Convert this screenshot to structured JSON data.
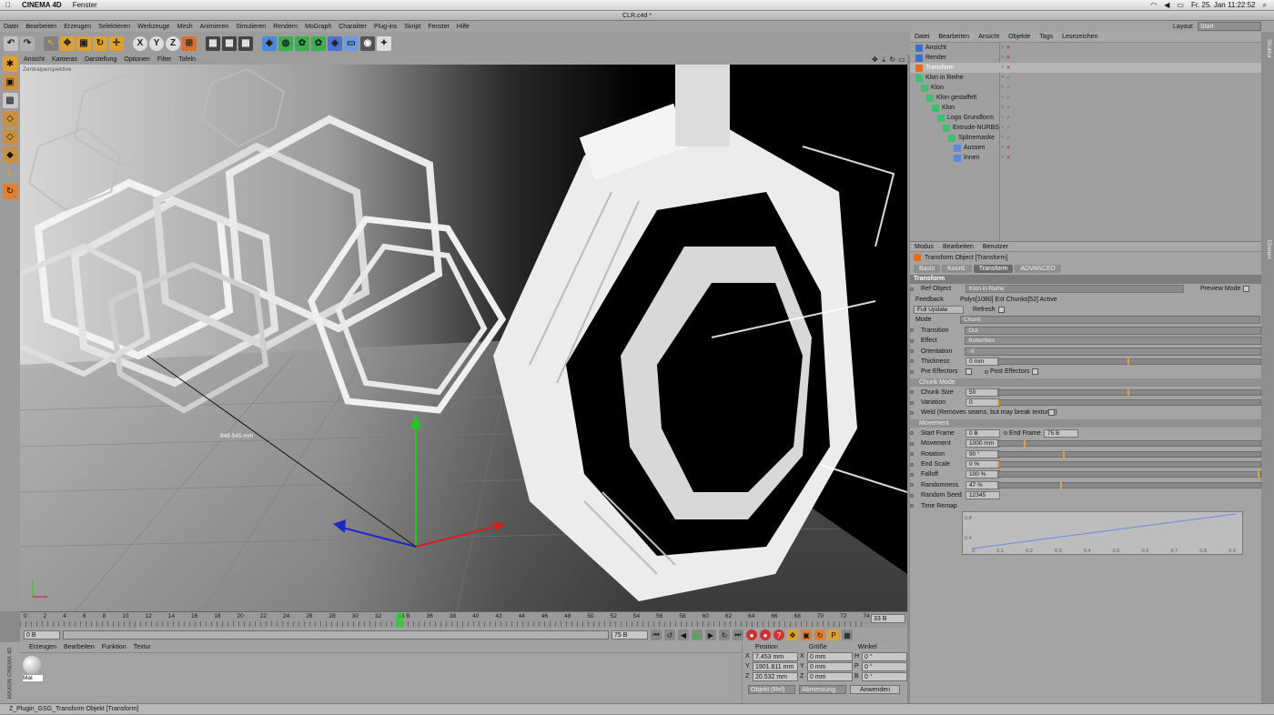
{
  "macbar": {
    "app": "CINEMA 4D",
    "menu": "Fenster",
    "clock": "Fr. 25. Jan  11:22:52"
  },
  "window_title": "CLR.c4d *",
  "main_menu": [
    "Datei",
    "Bearbeiten",
    "Erzeugen",
    "Selektieren",
    "Werkzeuge",
    "Mesh",
    "Animieren",
    "Simulieren",
    "Rendern",
    "MoGraph",
    "Charakter",
    "Plug-ins",
    "Skript",
    "Fenster",
    "Hilfe"
  ],
  "toolbar": {
    "x_label": "X",
    "y_label": "Y",
    "z_label": "Z"
  },
  "viewport": {
    "menu": [
      "Ansicht",
      "Kameras",
      "Darstellung",
      "Optionen",
      "Filter",
      "Tafeln"
    ],
    "name": "Zentralperspektive",
    "measure": "849.545 mm",
    "accent": "#2ad02a"
  },
  "timeline": {
    "ticks": [
      "0",
      "2",
      "4",
      "6",
      "8",
      "10",
      "12",
      "14",
      "16",
      "18",
      "20",
      "22",
      "24",
      "26",
      "28",
      "30",
      "32",
      "33 B",
      "36",
      "38",
      "40",
      "42",
      "44",
      "46",
      "48",
      "50",
      "52",
      "54",
      "56",
      "58",
      "60",
      "62",
      "64",
      "66",
      "68",
      "70",
      "72",
      "74"
    ],
    "end_field": "33 B",
    "start": "0 B",
    "end": "75 B"
  },
  "material": {
    "menu": [
      "Erzeugen",
      "Bearbeiten",
      "Funktion",
      "Textur"
    ],
    "name": "Mat"
  },
  "coords": {
    "headers": [
      "Position",
      "Größe",
      "Winkel"
    ],
    "rows": [
      {
        "axis": "X",
        "pos": "7.453 mm",
        "size_axis": "X",
        "size": "0 mm",
        "ang_axis": "H",
        "ang": "0 °"
      },
      {
        "axis": "Y",
        "pos": "1901.811 mm",
        "size_axis": "Y",
        "size": "0 mm",
        "ang_axis": "P",
        "ang": "0 °"
      },
      {
        "axis": "Z",
        "pos": "20.532 mm",
        "size_axis": "Z",
        "size": "0 mm",
        "ang_axis": "B",
        "ang": "0 °"
      }
    ],
    "btn_obj": "Objekt (Rel)",
    "btn_size": "Abmessung",
    "btn_apply": "Anwenden"
  },
  "status": "Z_Plugin_GSG_Transform Objekt [Transform]",
  "maxon": "MAXON CINEMA 4D",
  "layout": {
    "label": "Layout:",
    "value": "Start"
  },
  "objects": {
    "menu": [
      "Datei",
      "Bearbeiten",
      "Ansicht",
      "Objekte",
      "Tags",
      "Lesezeichen"
    ],
    "items": [
      {
        "name": "Ansicht",
        "indent": 0,
        "color": "#3a6fd0"
      },
      {
        "name": "Render",
        "indent": 0,
        "color": "#3a6fd0"
      },
      {
        "name": "Transform",
        "indent": 0,
        "color": "#e07020",
        "selected": true
      },
      {
        "name": "Klon in Reihe",
        "indent": 0,
        "color": "#3cc070"
      },
      {
        "name": "Klon",
        "indent": 1,
        "color": "#3cc070"
      },
      {
        "name": "Klon gestaffelt",
        "indent": 2,
        "color": "#3cc070"
      },
      {
        "name": "Klon",
        "indent": 3,
        "color": "#3cc070"
      },
      {
        "name": "Logo Grundform",
        "indent": 4,
        "color": "#3cc070"
      },
      {
        "name": "Extrude-NURBS",
        "indent": 5,
        "color": "#3cc070"
      },
      {
        "name": "Splinemaske",
        "indent": 6,
        "color": "#3cc070"
      },
      {
        "name": "Aussen",
        "indent": 7,
        "color": "#5a8ad8"
      },
      {
        "name": "Innen",
        "indent": 7,
        "color": "#5a8ad8"
      }
    ]
  },
  "right_tabs": [
    "Objekte",
    "Content Browser",
    "Struktur"
  ],
  "right_tabs2": [
    "Attribute",
    "Ebenen"
  ],
  "attributes": {
    "menu": [
      "Modus",
      "Bearbeiten",
      "Benutzer"
    ],
    "object_title": "Transform Object [Transform]",
    "tabs": [
      "Basis",
      "Koord.",
      "Transform",
      "ADVANCED"
    ],
    "section": "Transform",
    "ref_label": "Ref Object",
    "ref_value": "Klon in Reihe",
    "preview_label": "Preview Mode",
    "feedback_label": "Feedback",
    "feedback_value": "Polys[1080]  Est Chunks[52]   Active",
    "full_update": "Full Update",
    "refresh": "Refresh",
    "mode_label": "Mode",
    "mode_value": "Chunk",
    "transition_label": "Transition",
    "transition_value": "Out",
    "effect_label": "Effect",
    "effect_value": "Butterflies",
    "orientation_label": "Orientation",
    "orientation_value": "-X",
    "thickness_label": "Thickness",
    "thickness_value": "0 mm",
    "thickness_level": 0.5,
    "pre_effectors": "Pre Effectors",
    "post_effectors": "Post Effectors",
    "chunk_section": "Chunk Mode",
    "chunk_size_label": "Chunk Size",
    "chunk_size_value": "50",
    "chunk_size_level": 0.5,
    "variation_label": "Variation",
    "variation_value": "0",
    "variation_level": 0,
    "weld_label": "Weld (Removes seams, but may break textures)",
    "movement_section": "Movement",
    "start_frame_label": "Start Frame",
    "start_frame_value": "0 B",
    "end_frame_label": "End Frame",
    "end_frame_value": "75 B",
    "movement_label": "Movement",
    "movement_value": "1000 mm",
    "movement_level": 0.1,
    "rotation_label": "Rotation",
    "rotation_value": "90 °",
    "rotation_level": 0.25,
    "endscale_label": "End Scale",
    "endscale_value": "0 %",
    "endscale_level": 0,
    "falloff_label": "Falloff",
    "falloff_value": "100 %",
    "falloff_level": 1.0,
    "randomness_label": "Randomness",
    "randomness_value": "47 %",
    "randomness_level": 0.24,
    "seed_label": "Random Seed",
    "seed_value": "12345",
    "time_remap_label": "Time Remap",
    "graph_x": [
      "0",
      "0.1",
      "0.2",
      "0.3",
      "0.4",
      "0.5",
      "0.6",
      "0.7",
      "0.8",
      "0.9"
    ],
    "graph_y": [
      "0.8",
      "0.4"
    ]
  }
}
